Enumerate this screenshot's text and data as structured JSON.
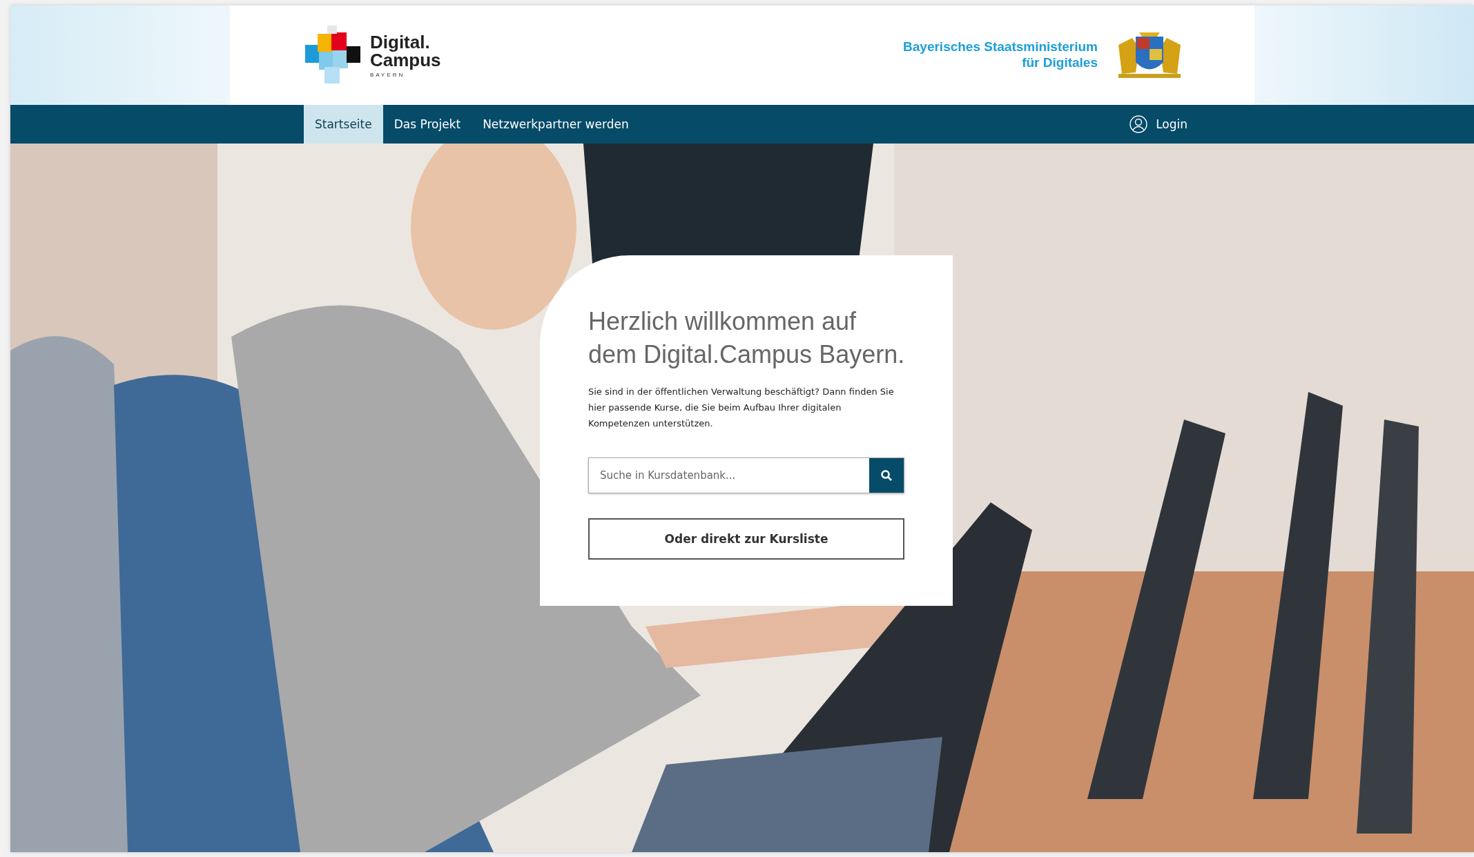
{
  "header": {
    "logo": {
      "lines": [
        "Digital.",
        "Campus"
      ],
      "tagline": "BAYERN"
    },
    "ministry": {
      "lines": [
        "Bayerisches Staatsministerium",
        "für Digitales"
      ]
    }
  },
  "nav": {
    "items": [
      {
        "label": "Startseite",
        "selected": true
      },
      {
        "label": "Das Projekt",
        "selected": false
      },
      {
        "label": "Netzwerkpartner werden",
        "selected": false
      }
    ],
    "login": "Login"
  },
  "hero": {
    "kind": "picture",
    "card": {
      "title_lines": [
        "Herzlich willkommen auf",
        "dem Digital.Campus Bayern."
      ],
      "text": "Sie sind in der öffentlichen Verwaltung beschäftigt? Dann finden Sie hier passende Kurse, die Sie beim Aufbau Ihrer digitalen Kompetenzen unterstützen.",
      "search": {
        "placeholder": "Suche in Kursdatenbank..."
      },
      "button": "Oder direkt zur Kursliste"
    }
  }
}
